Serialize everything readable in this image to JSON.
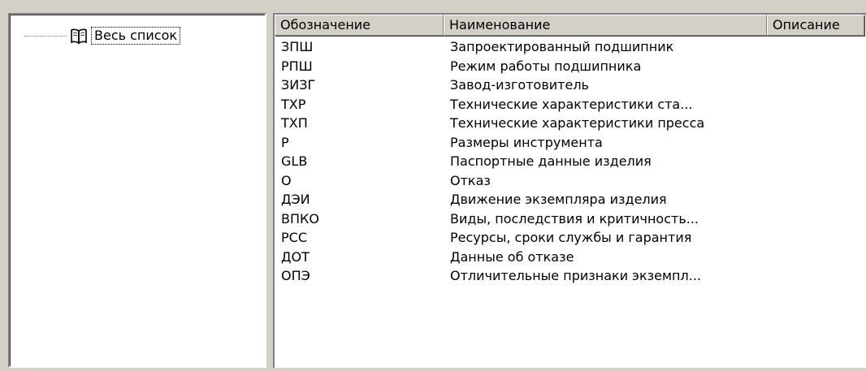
{
  "tree": {
    "root_label": "Весь список"
  },
  "list": {
    "columns": [
      "Обозначение",
      "Наименование",
      "Описание"
    ],
    "rows": [
      {
        "code": "ЗПШ",
        "name": "Запроектированный подшипник"
      },
      {
        "code": "РПШ",
        "name": "Режим работы подшипника"
      },
      {
        "code": "ЗИЗГ",
        "name": "Завод-изготовитель"
      },
      {
        "code": "ТХР",
        "name": "Технические характеристики ста..."
      },
      {
        "code": "ТХП",
        "name": "Технические характеристики пресса"
      },
      {
        "code": "Р",
        "name": "Размеры инструмента"
      },
      {
        "code": "GLB",
        "name": "Паспортные данные изделия"
      },
      {
        "code": "О",
        "name": "Отказ"
      },
      {
        "code": "ДЭИ",
        "name": "Движение экземпляра изделия"
      },
      {
        "code": "ВПКО",
        "name": "Виды, последствия и критичность..."
      },
      {
        "code": "РСС",
        "name": "Ресурсы, сроки службы и гарантия"
      },
      {
        "code": "ДОТ",
        "name": "Данные об отказе"
      },
      {
        "code": "ОПЭ",
        "name": "Отличительные признаки экземпл..."
      }
    ]
  },
  "icons": {
    "tree_root": "open-book-icon"
  }
}
